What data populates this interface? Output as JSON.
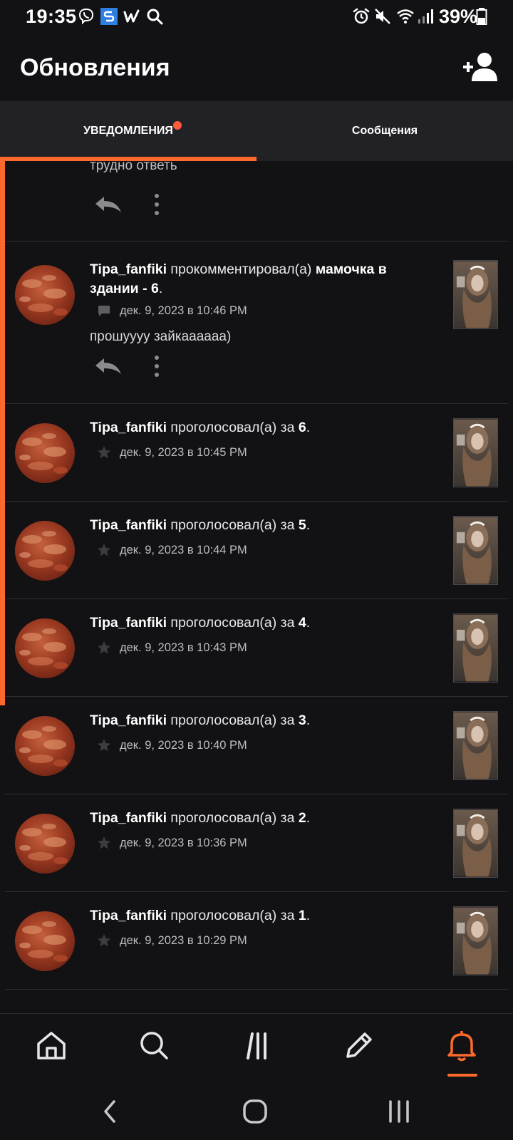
{
  "status_bar": {
    "time": "19:35",
    "battery_percent": "39%",
    "left_icons": [
      "viber-icon",
      "s-app-icon",
      "w-app-icon",
      "search-icon"
    ],
    "right_icons": [
      "alarm-icon",
      "mute-icon",
      "wifi-icon",
      "signal-icon",
      "battery-icon"
    ]
  },
  "header": {
    "title": "Обновления",
    "add_friend_icon": "add-user-icon"
  },
  "tabs": [
    {
      "label": "УВЕДОМЛЕНИЯ",
      "active": true,
      "has_badge": true
    },
    {
      "label": "Сообщения",
      "active": false,
      "has_badge": false
    }
  ],
  "colors": {
    "accent": "#ff6a2c",
    "background": "#121114",
    "tab_bar": "#222126",
    "badge": "#ff5a3c"
  },
  "notifications": {
    "partial_top": {
      "comment": "трудно ответь"
    },
    "comment_item": {
      "user": "Tipa_fanfiki",
      "action": " прокомментировал(а) ",
      "story": "мамочка в здании - 6",
      "suffix": ".",
      "date": "дек. 9, 2023 в 10:46 PM",
      "comment": "прошуууу зайкаааааа)"
    },
    "votes": [
      {
        "user": "Tipa_fanfiki",
        "action": " проголосовал(а) за ",
        "part": "6",
        "suffix": ".",
        "date": "дек. 9, 2023 в 10:45 PM",
        "unread": true
      },
      {
        "user": "Tipa_fanfiki",
        "action": " проголосовал(а) за ",
        "part": "5",
        "suffix": ".",
        "date": "дек. 9, 2023 в 10:44 PM",
        "unread": true
      },
      {
        "user": "Tipa_fanfiki",
        "action": " проголосовал(а) за ",
        "part": "4",
        "suffix": ".",
        "date": "дек. 9, 2023 в 10:43 PM",
        "unread": true
      },
      {
        "user": "Tipa_fanfiki",
        "action": " проголосовал(а) за ",
        "part": "3",
        "suffix": ".",
        "date": "дек. 9, 2023 в 10:40 PM",
        "unread": false
      },
      {
        "user": "Tipa_fanfiki",
        "action": " проголосовал(а) за ",
        "part": "2",
        "suffix": ".",
        "date": "дек. 9, 2023 в 10:36 PM",
        "unread": false
      },
      {
        "user": "Tipa_fanfiki",
        "action": " проголосовал(а) за ",
        "part": "1",
        "suffix": ".",
        "date": "дек. 9, 2023 в 10:29 PM",
        "unread": false
      }
    ]
  },
  "bottom_nav": [
    {
      "icon": "home-icon",
      "active": false
    },
    {
      "icon": "search-icon",
      "active": false
    },
    {
      "icon": "library-icon",
      "active": false
    },
    {
      "icon": "write-icon",
      "active": false
    },
    {
      "icon": "bell-icon",
      "active": true
    }
  ],
  "system_nav": [
    "back-icon",
    "home-circle-icon",
    "recents-icon"
  ]
}
